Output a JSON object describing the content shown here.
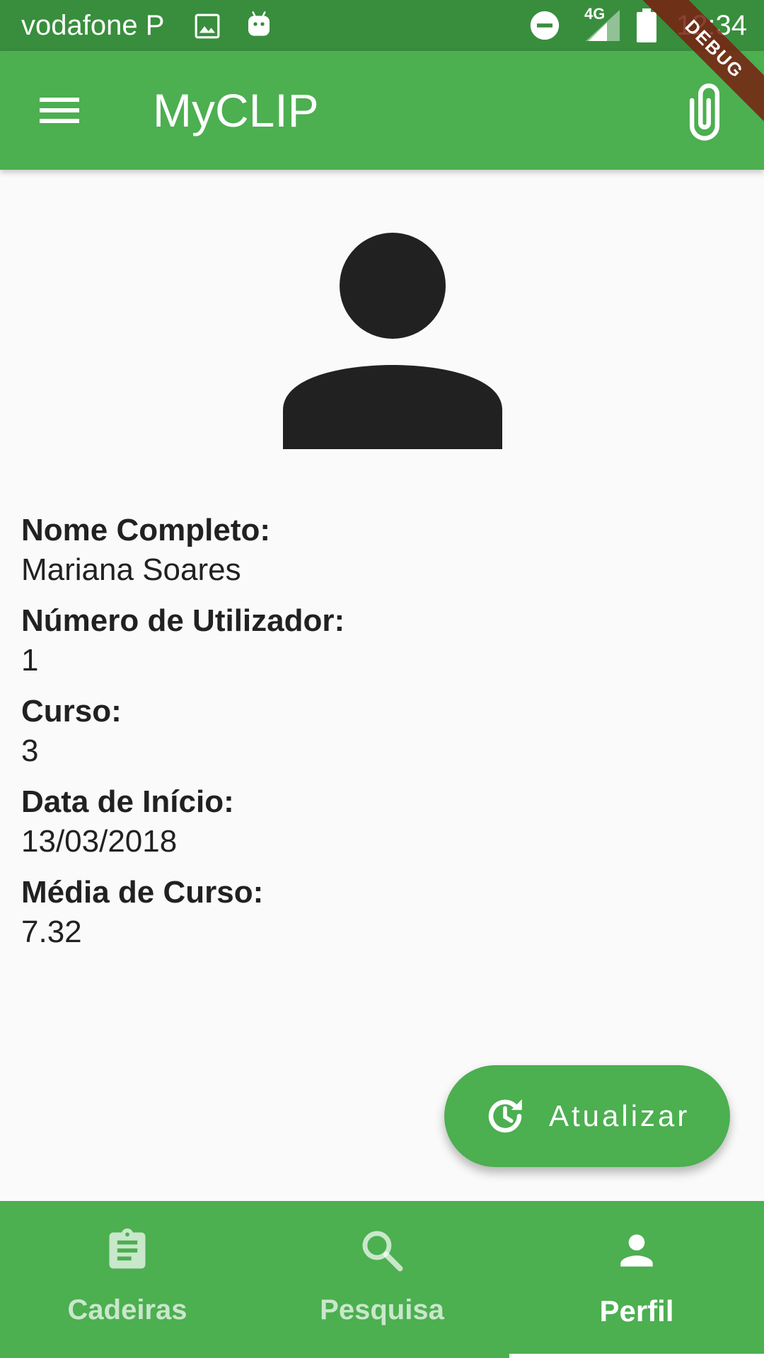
{
  "status_bar": {
    "carrier": "vodafone P",
    "time": "12:34",
    "network": "4G"
  },
  "debug_banner": "DEBUG",
  "app_bar": {
    "title": "MyCLIP"
  },
  "profile": {
    "fields": [
      {
        "label": "Nome Completo:",
        "value": "Mariana Soares"
      },
      {
        "label": "Número de Utilizador:",
        "value": "1"
      },
      {
        "label": "Curso:",
        "value": "3"
      },
      {
        "label": "Data de Início:",
        "value": "13/03/2018"
      },
      {
        "label": "Média de Curso:",
        "value": "7.32"
      }
    ]
  },
  "fab": {
    "label": "Atualizar"
  },
  "bottom_nav": {
    "items": [
      {
        "label": "Cadeiras",
        "icon": "clipboard-icon"
      },
      {
        "label": "Pesquisa",
        "icon": "search-icon"
      },
      {
        "label": "Perfil",
        "icon": "person-icon",
        "active": true
      }
    ]
  },
  "colors": {
    "status_bar": "#388e3c",
    "primary": "#4caf50",
    "text": "#212121"
  }
}
